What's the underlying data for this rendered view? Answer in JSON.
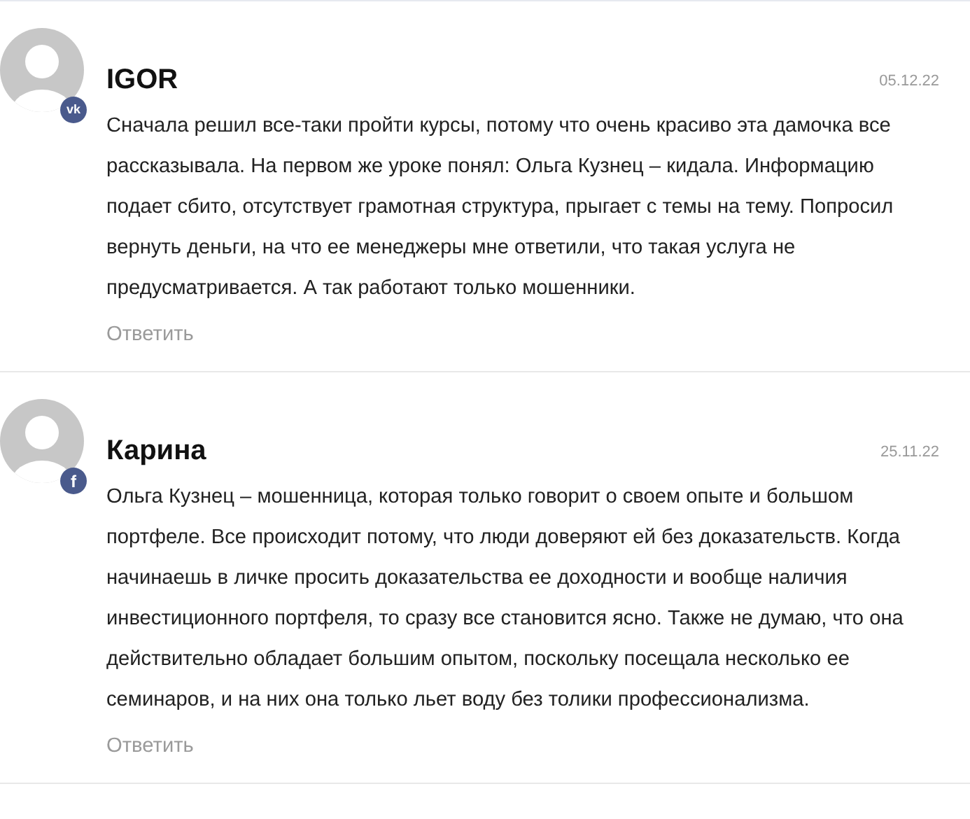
{
  "comments": [
    {
      "author": "IGOR",
      "date": "05.12.22",
      "social": {
        "kind": "vk",
        "glyph": "vk"
      },
      "text": "Сначала решил все-таки пройти курсы, потому что очень красиво эта дамочка все рассказывала. На первом же уроке понял: Ольга Кузнец – кидала. Информацию подает сбито, отсутствует грамотная структура, прыгает с темы на тему. Попросил вернуть деньги, на что ее менеджеры мне ответили, что такая услуга не предусматривается. А так работают только мошенники.",
      "reply": "Ответить"
    },
    {
      "author": "Карина",
      "date": "25.11.22",
      "social": {
        "kind": "facebook",
        "glyph": "f"
      },
      "text": "Ольга Кузнец – мошенница, которая только говорит о своем опыте и большом портфеле. Все происходит потому, что люди доверяют ей без доказательств. Когда начинаешь в личке просить доказательства ее доходности и вообще наличия инвестиционного портфеля, то сразу все становится ясно. Также не думаю, что она действительно обладает большим опытом, поскольку посещала несколько ее семинаров, и на них она только льет воду без толики профессионализма.",
      "reply": "Ответить"
    }
  ]
}
